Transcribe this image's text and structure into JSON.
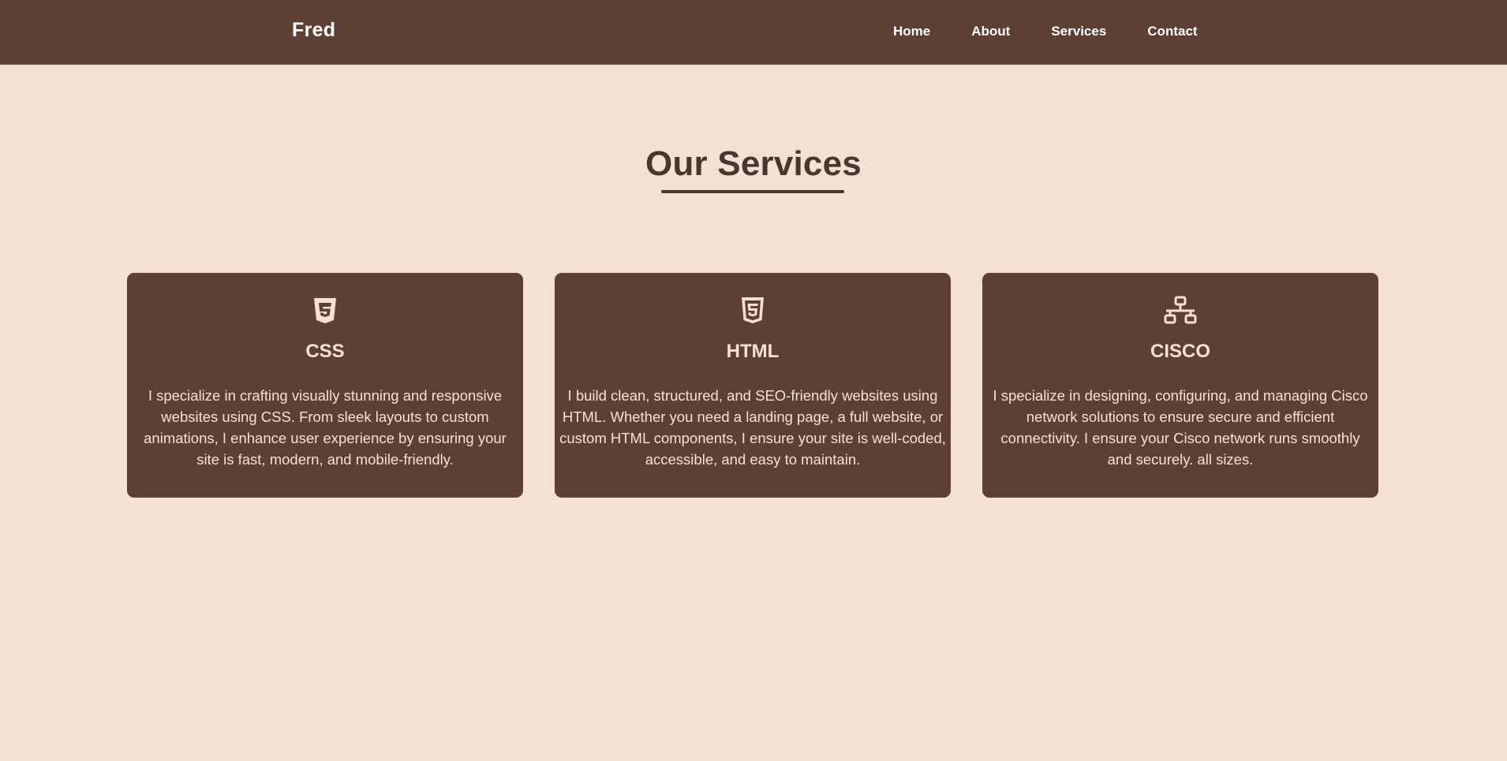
{
  "header": {
    "brand": "Fred",
    "nav": [
      "Home",
      "About",
      "Services",
      "Contact"
    ]
  },
  "services": {
    "title": "Our Services",
    "cards": [
      {
        "icon": "css3-icon",
        "title": "CSS",
        "text": "I specialize in crafting visually stunning and responsive websites using CSS. From sleek layouts to custom animations, I enhance user experience by ensuring your site is fast, modern, and mobile-friendly."
      },
      {
        "icon": "html5-icon",
        "title": "HTML",
        "text": "I build clean, structured, and SEO-friendly websites using HTML. Whether you need a landing page, a full website, or custom HTML components, I ensure your site is well-coded, accessible, and easy to maintain."
      },
      {
        "icon": "network-icon",
        "title": "CISCO",
        "text": "I specialize in designing, configuring, and managing Cisco network solutions to ensure secure and efficient connectivity. I ensure your Cisco network runs smoothly and securely. all sizes."
      }
    ]
  },
  "colors": {
    "background": "#f5e1d3",
    "header_bg": "#5c4033",
    "card_bg": "#5c4033",
    "title_text": "#4a3631",
    "card_text": "#f5e1d3"
  }
}
